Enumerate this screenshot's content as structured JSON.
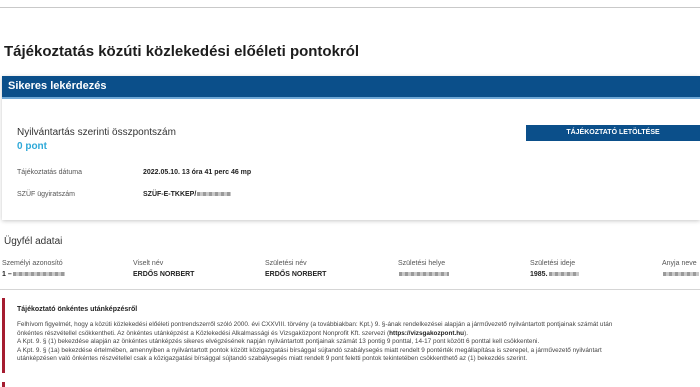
{
  "page": {
    "title": "Tájékoztatás közúti közlekedési előéleti pontokról"
  },
  "result": {
    "header": "Sikeres lekérdezés",
    "total_label": "Nyilvántartás szerinti összpontszám",
    "total_value": "0 pont",
    "download_label": "TÁJÉKOZTATÓ LETÖLTÉSE",
    "date_label": "Tájékoztatás dátuma",
    "date_value": "2022.05.10. 13 óra 41 perc 46 mp",
    "case_label": "SZÜF ügyiratszám",
    "case_value": "SZÜF-E-TKKEP/"
  },
  "client": {
    "title": "Ügyfél adatai",
    "columns": [
      {
        "label": "Személyi azonosító",
        "value": "1 –"
      },
      {
        "label": "Viselt név",
        "value": "ERDŐS NORBERT"
      },
      {
        "label": "Születési név",
        "value": "ERDŐS NORBERT"
      },
      {
        "label": "Születési helye",
        "value": ""
      },
      {
        "label": "Születési ideje",
        "value": "1985."
      },
      {
        "label": "Anyja neve",
        "value": ""
      }
    ]
  },
  "info": {
    "title": "Tájékoztató önkéntes utánképzésről",
    "line1": "Felhívom figyelmét, hogy a közúti közlekedési előéleti pontrendszerről szóló 2000. évi CXXVIII. törvény (a továbbiakban: Kpt.) 9. §-ának rendelkezései alapján a járművezető nyilvántartott pontjainak számát után",
    "line2": "önkéntes részvétellel csökkentheti. Az önkéntes utánképzést a Közlekedési Alkalmassági és Vizsgaközpont Nonprofit Kft. szervezi (",
    "link": "https://vizsgakozpont.hu",
    "line2_end": ").",
    "line3": "A Kpt. 9. § (1) bekezdése alapján az önkéntes utánképzés sikeres elvégzésének napján nyilvántartott pontjainak számát 13 pontig 9 ponttal, 14-17 pont között 6 ponttal kell csökkenteni.",
    "line4": "A Kpt. 9. § (1a) bekezdése értelmében, amennyiben a nyilvántartott pontok között közigazgatási bírsággal sújtandó szabálysegés miatt rendelt 9 pontérték megállapítása is szerepel, a járművezető nyilvántart",
    "line5": "utánképzésen való önkéntes részvétellel csak a közigazgatási bírsággal sújtandó szabálysegés miatt rendelt 9 pont feletti pontok tekintetében csökkenthető az (1) bekezdés szerint."
  },
  "colors": {
    "primary": "#0b4f8a",
    "accent": "#2fa9d8",
    "alert": "#a51c30"
  }
}
